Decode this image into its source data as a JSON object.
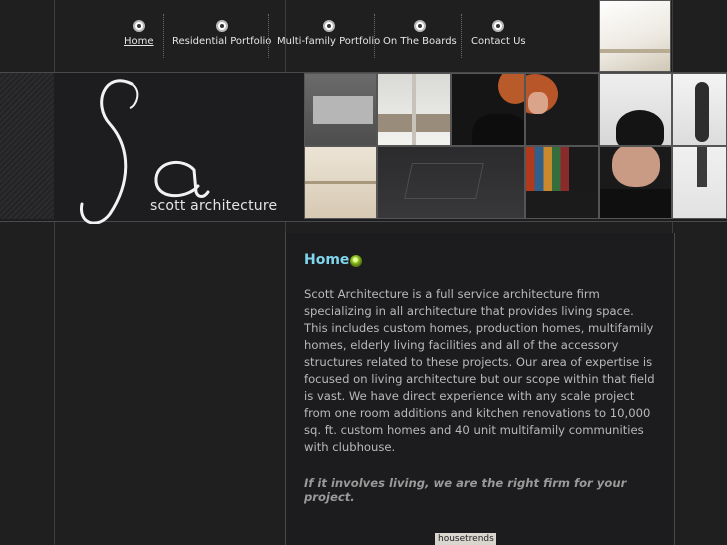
{
  "nav": {
    "items": [
      {
        "label": "Home",
        "active": true
      },
      {
        "label": "Residential Portfolio",
        "active": false
      },
      {
        "label": "Multi-family Portfolio",
        "active": false
      },
      {
        "label": "On The Boards",
        "active": false
      },
      {
        "label": "Contact Us",
        "active": false
      }
    ]
  },
  "logo": {
    "monogram": "Sa",
    "name": "scott architecture"
  },
  "main": {
    "title": "Home",
    "body": "Scott Architecture is a full service architecture firm specializing in all architecture that provides living space. This includes custom homes, production homes, multifamily homes, elderly living facilities and all of the accessory structures related to these projects. Our area of expertise is focused on living architecture but our scope within that field is vast. We have direct experience with any scale project from one room additions and kitchen renovations to 10,000 sq. ft. custom homes and 40 unit multifamily communities with clubhouse.",
    "tagline": "If it involves living, we are the right firm for your project.",
    "badge": "housetrends"
  },
  "colors": {
    "background": "#1f1f20",
    "title_accent": "#7fd6ee",
    "bullet": "#9ccc2a"
  }
}
